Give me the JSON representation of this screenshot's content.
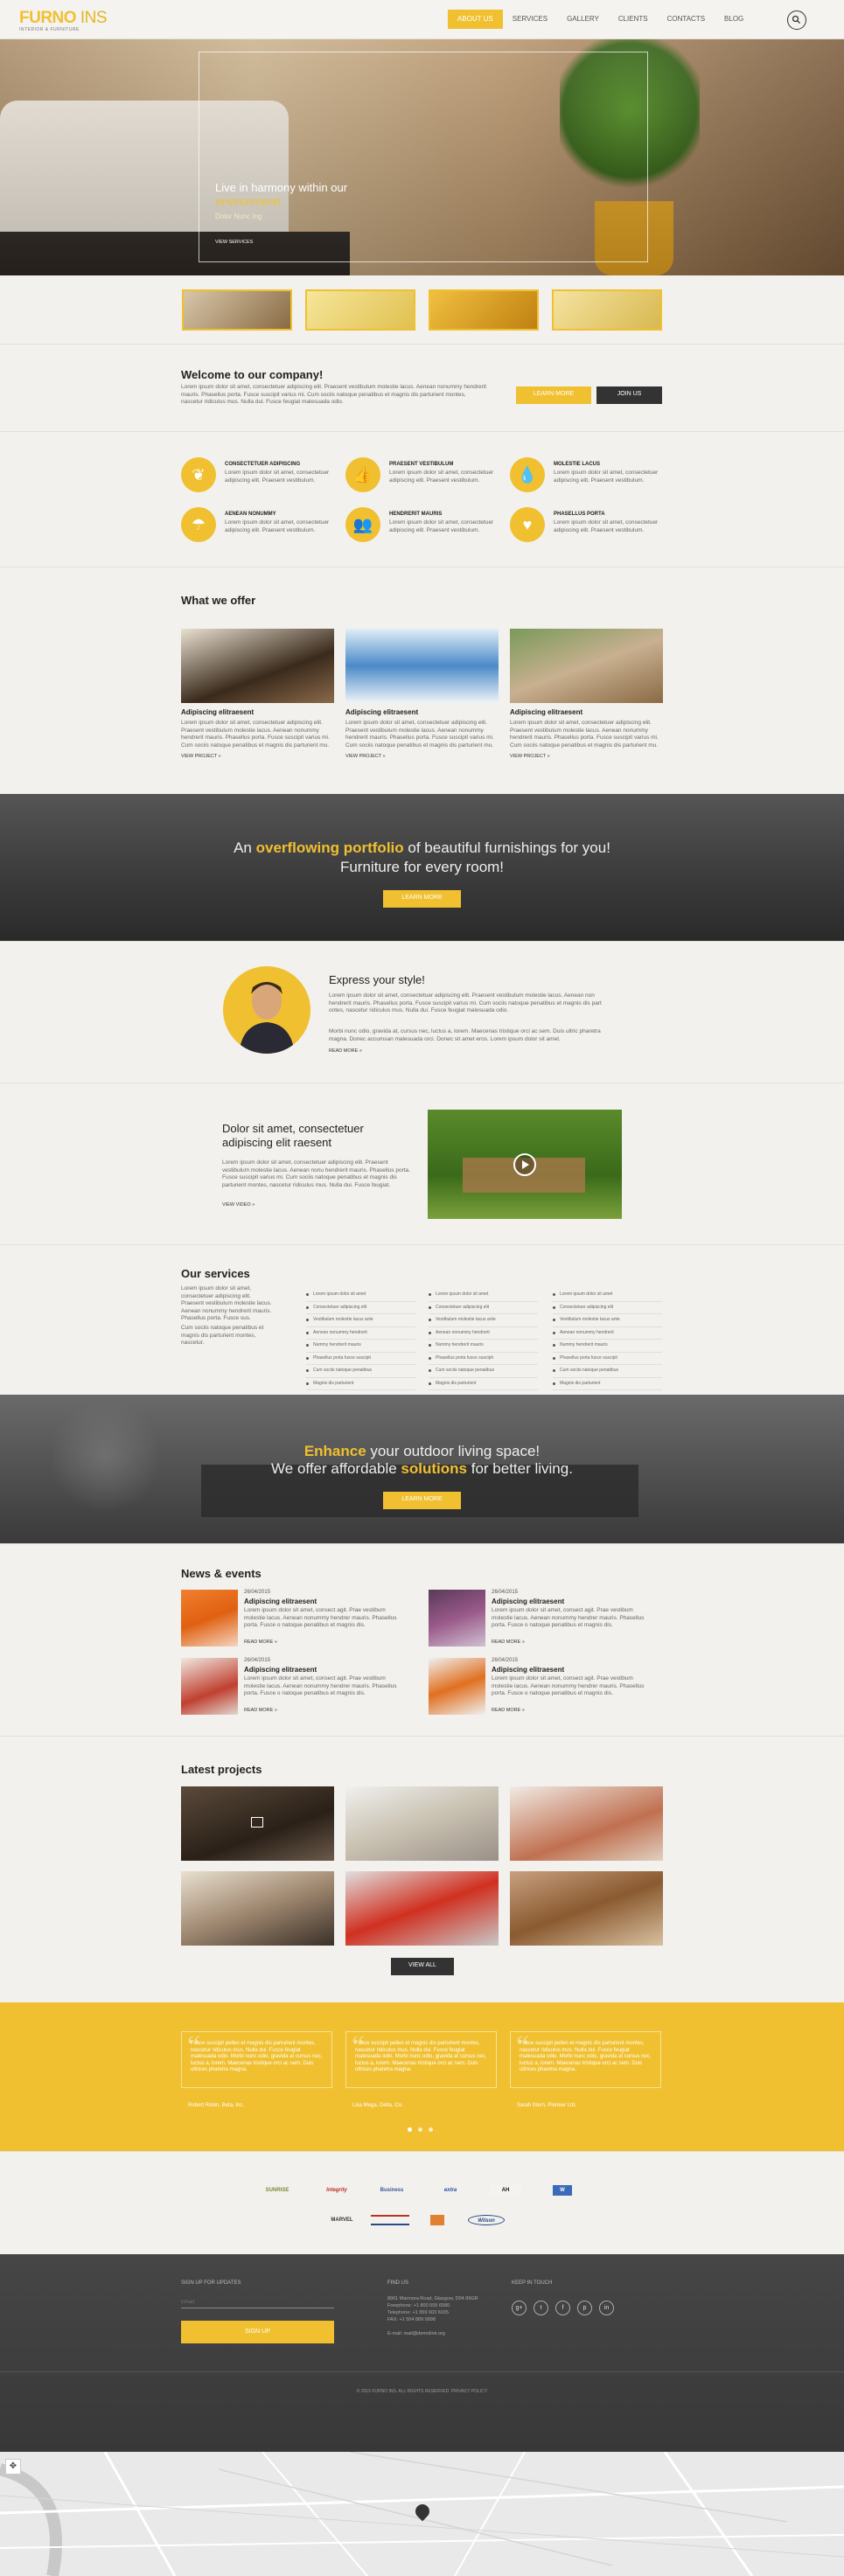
{
  "brand": {
    "name_bold": "FURNO",
    "name_light": "INS",
    "tagline": "INTERIOR & FURNITURE"
  },
  "nav": [
    "ABOUT US",
    "SERVICES",
    "GALLERY",
    "CLIENTS",
    "CONTACTS",
    "BLOG"
  ],
  "hero": {
    "title_line1": "Live in harmony within our",
    "title_highlight": "environment!",
    "subtitle": "Dolor Nunc Ing",
    "link": "VIEW SERVICES"
  },
  "welcome": {
    "title": "Welcome to our company!",
    "text": "Lorem ipsum dolor sit amet, consectetuer adipiscing elit. Praesent vestibulum molestie lacus. Aenean nonummy hendrerit mauris. Phasellus porta. Fusce suscipit varius mi. Cum sociis natoque penatibus et magnis dis parturient montes, nascetur ridiculus mus. Nulla dui. Fusce feugiat malesuada odio.",
    "btn_learn": "LEARN MORE",
    "btn_join": "JOIN US"
  },
  "features": [
    {
      "title": "CONSECTETUER ADIPISCING",
      "text": "Lorem ipsum dolor sit amet, consectetuer adipiscing elit. Praesent vestibulum.",
      "icon": "leaf-icon",
      "glyph": "❦"
    },
    {
      "title": "PRAESENT VESTIBULUM",
      "text": "Lorem ipsum dolor sit amet, consectetuer adipiscing elit. Praesent vestibulum.",
      "icon": "thumbs-up-icon",
      "glyph": "👍"
    },
    {
      "title": "MOLESTIE LACUS",
      "text": "Lorem ipsum dolor sit amet, consectetuer adipiscing elit. Praesent vestibulum.",
      "icon": "drop-icon",
      "glyph": "💧"
    },
    {
      "title": "AENEAN NONUMMY",
      "text": "Lorem ipsum dolor sit amet, consectetuer adipiscing elit. Praesent vestibulum.",
      "icon": "umbrella-icon",
      "glyph": "☂"
    },
    {
      "title": "HENDRERIT MAURIS",
      "text": "Lorem ipsum dolor sit amet, consectetuer adipiscing elit. Praesent vestibulum.",
      "icon": "users-icon",
      "glyph": "👥"
    },
    {
      "title": "PHASELLUS PORTA",
      "text": "Lorem ipsum dolor sit amet, consectetuer adipiscing elit. Praesent vestibulum.",
      "icon": "heart-icon",
      "glyph": "♥"
    }
  ],
  "offer": {
    "title": "What we offer",
    "items": [
      {
        "title": "Adipiscing elitraesent",
        "text": "Lorem ipsum dolor sit amet, consectetuer adipiscing elit. Praesent vestibulum molestie lacus. Aenean nonummy hendrerit mauris. Phasellus porta. Fusce suscipit varius mi. Cum sociis natoque penatibus et magnis dis parturient mu.",
        "link": "VIEW PROJECT »"
      },
      {
        "title": "Adipiscing elitraesent",
        "text": "Lorem ipsum dolor sit amet, consectetuer adipiscing elit. Praesent vestibulum molestie lacus. Aenean nonummy hendrerit mauris. Phasellus porta. Fusce suscipit varius mi. Cum sociis natoque penatibus et magnis dis parturient mu.",
        "link": "VIEW PROJECT »"
      },
      {
        "title": "Adipiscing elitraesent",
        "text": "Lorem ipsum dolor sit amet, consectetuer adipiscing elit. Praesent vestibulum molestie lacus. Aenean nonummy hendrerit mauris. Phasellus porta. Fusce suscipit varius mi. Cum sociis natoque penatibus et magnis dis parturient mu.",
        "link": "VIEW PROJECT »"
      }
    ]
  },
  "portfolio": {
    "pre": "An",
    "highlight": "overflowing portfolio",
    "post": "of beautiful furnishings for you!",
    "line2": "Furniture for every room!",
    "btn": "LEARN MORE"
  },
  "express": {
    "title": "Express your style!",
    "text1": "Lorem ipsum dolor sit amet, consectetuer adipiscing elit. Praesent vestibulum molestie lacus. Aenean non hendrerit mauris. Phasellus porta. Fusce suscipit varius mi. Cum sociis natoque penatibus et magnis dis part ontes, nascetur ridiculus mus. Nulla dui. Fusce feugiat malesuada odio.",
    "text2": "Morbi nunc odio, gravida at, cursus nec, luctus a, lorem. Maecenas tristique orci ac sem. Duis ultric pharetra magna. Donec accumsan malesuada orci. Donec sit amet eros. Lorem ipsum dolor sit amet.",
    "link": "READ MORE »"
  },
  "dolor": {
    "title": "Dolor sit amet, consectetuer adipiscing elit raesent",
    "text": "Lorem ipsum dolor sit amet, consectetuer adipiscing elit. Praesent vestibulum molestie lacus. Aenean nonu hendrerit mauris. Phasellus porta. Fusce suscipit varius mi. Cum sociis natoque penatibus et magnis dis parturient montes, nascetur ridiculus mus. Nulla dui. Fusce feugiat.",
    "link": "VIEW VIDEO »"
  },
  "services": {
    "title": "Our services",
    "text1": "Lorem ipsum dolor sit amet, consectetuer adipiscing elit. Praesent vestibulum molestie lacus. Aenean nonummy hendrerit mauris. Phasellus porta. Fusce sus.",
    "text2": "Cum sociis natoque penatibus et magnis dis parturient montes, nascetur.",
    "cols": [
      [
        "Lorem ipsum dolor sit amet",
        "Consectetuer adipiscing elit",
        "Vestibulum molestie lacus ante",
        "Aenean nonummy hendrerit",
        "Nummy hendrerit mauris",
        "Phasellus porta fusce suscipit",
        "Cum sociis natoque penatibus",
        "Magnis dis parturient"
      ],
      [
        "Lorem ipsum dolor sit amet",
        "Consectetuer adipiscing elit",
        "Vestibulum molestie lacus ante",
        "Aenean nonummy hendrerit",
        "Nummy hendrerit mauris",
        "Phasellus porta fusce suscipit",
        "Cum sociis natoque penatibus",
        "Magnis dis parturient"
      ],
      [
        "Lorem ipsum dolor sit amet",
        "Consectetuer adipiscing elit",
        "Vestibulum molestie lacus ante",
        "Aenean nonummy hendrerit",
        "Nummy hendrerit mauris",
        "Phasellus porta fusce suscipit",
        "Cum sociis natoque penatibus",
        "Magnis dis parturient"
      ]
    ]
  },
  "enhance": {
    "h1": "Enhance",
    "l1": "your outdoor living space!",
    "l2a": "We offer affordable",
    "h2": "solutions",
    "l2b": "for better living.",
    "btn": "LEARN MORE"
  },
  "news": {
    "title": "News & events",
    "items": [
      {
        "date": "26/04/2015",
        "title": "Adipiscing elitraesent",
        "text": "Lorem ipsum dolor sit amet, consect agit. Prae vestibum molestie lacus. Aenean nonummy hendrer mauris. Phasellus porta. Fusce o natoque penatibus et magnis dis.",
        "link": "READ MORE »"
      },
      {
        "date": "26/04/2015",
        "title": "Adipiscing elitraesent",
        "text": "Lorem ipsum dolor sit amet, consect agit. Prae vestibum molestie lacus. Aenean nonummy hendrer mauris. Phasellus porta. Fusce o natoque penatibus et magnis dis.",
        "link": "READ MORE »"
      },
      {
        "date": "26/04/2015",
        "title": "Adipiscing elitraesent",
        "text": "Lorem ipsum dolor sit amet, consect agit. Prae vestibum molestie lacus. Aenean nonummy hendrer mauris. Phasellus porta. Fusce o natoque penatibus et magnis dis.",
        "link": "READ MORE »"
      },
      {
        "date": "26/04/2015",
        "title": "Adipiscing elitraesent",
        "text": "Lorem ipsum dolor sit amet, consect agit. Prae vestibum molestie lacus. Aenean nonummy hendrer mauris. Phasellus porta. Fusce o natoque penatibus et magnis dis.",
        "link": "READ MORE »"
      }
    ]
  },
  "projects": {
    "title": "Latest projects",
    "btn": "VIEW ALL"
  },
  "testimonials": [
    {
      "text": "Fusce suscipit pellen et magnis dis parturient montes, nascetur ridiculus mus. Nulla dui. Fusce feugiat malesuada odio. Morbi nunc odio, gravida at cursus nec, luctus a, lorem. Maecenas tristique orci ac sem. Duis ultrices pharetra magna.",
      "name": "Robert Robin, Beta, Inc."
    },
    {
      "text": "Fusce suscipit pellen et magnis dis parturient montes, nascetur ridiculus mus. Nulla dui. Fusce feugiat malesuada odio. Morbi nunc odio, gravida at cursus nec, luctus a, lorem. Maecenas tristique orci ac sem. Duis ultrices pharetra magna.",
      "name": "Lisa Mega, Delta, Co."
    },
    {
      "text": "Fusce suscipit pellen et magnis dis parturient montes, nascetur ridiculus mus. Nulla dui. Fusce feugiat malesuada odio. Morbi nunc odio, gravida at cursus nec, luctus a, lorem. Maecenas tristique orci ac sem. Duis ultrices pharetra magna.",
      "name": "Sarah Stern, Pioneer Ltd."
    }
  ],
  "logos": [
    "SUNRISE",
    "Integrity",
    "Business",
    "extra",
    "AH",
    "W",
    "MARVEL",
    "",
    "",
    "Wilson"
  ],
  "footer": {
    "signup": "SIGN UP FOR UPDATES",
    "email_ph": "Email",
    "signup_btn": "SIGN UP",
    "find": "FIND US",
    "address": "8901 Marmora Road, Glasgow, D04 89GR",
    "freephone": "Freephone: +1 800 559 6580",
    "telephone": "Telephone: +1 959 603 6035",
    "fax": "FAX: +1 504 889 9898",
    "email": "E-mail: mail@demolink.org",
    "keep": "KEEP IN TOUCH",
    "copy": "© 2015 FURNO INS. ALL RIGHTS RESERVED. PRIVACY POLICY"
  },
  "colors": {
    "accent": "#f0c030",
    "dark": "#333333"
  }
}
